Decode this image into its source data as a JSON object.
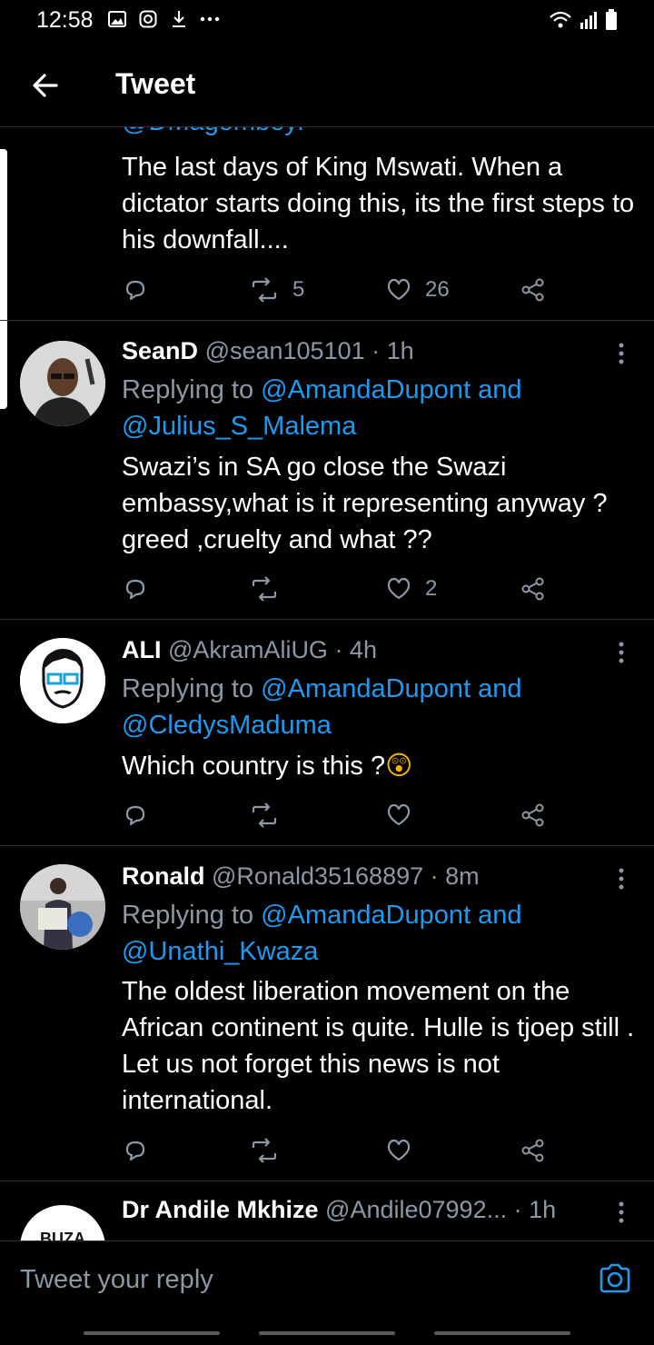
{
  "status": {
    "time": "12:58"
  },
  "header": {
    "title": "Tweet"
  },
  "tweets": [
    {
      "handle_partial": "@DMagombeyi",
      "text": "The last days of King Mswati. When a dictator starts doing this, its the first steps to his downfall....",
      "retweets": "5",
      "likes": "26"
    },
    {
      "name": "SeanD",
      "handle": "@sean105101 · 1h",
      "replying_prefix": "Replying to ",
      "mention1": "@AmandaDupont and",
      "mention2": "@Julius_S_Malema",
      "text": "Swazi’s in SA go close the Swazi embassy,what is it representing anyway ? greed ,cruelty and what ??",
      "retweets": "",
      "likes": "2"
    },
    {
      "name": "ALI",
      "handle": "@AkramAliUG · 4h",
      "replying_prefix": "Replying to ",
      "mention1": "@AmandaDupont and",
      "mention2": "@CledysMaduma",
      "text": "Which country is this ?",
      "emoji": "😲",
      "retweets": "",
      "likes": ""
    },
    {
      "name": "Ronald",
      "handle": "@Ronald35168897 · 8m",
      "replying_prefix": "Replying to ",
      "mention1": "@AmandaDupont and",
      "mention2": "@Unathi_Kwaza",
      "text": "The oldest liberation movement on the African continent is quite. Hulle is tjoep still . Let us not forget this news is not international.",
      "retweets": "",
      "likes": ""
    },
    {
      "name": "Dr Andile Mkhize",
      "handle": "@Andile07992...",
      "time": " · 1h",
      "avatar_text": "BUZA"
    }
  ],
  "compose": {
    "placeholder": "Tweet your reply"
  },
  "icons": {
    "back": "arrow-left-icon",
    "reply": "reply-icon",
    "retweet": "retweet-icon",
    "like": "heart-icon",
    "share": "share-icon",
    "more": "more-vertical-icon",
    "camera": "camera-icon"
  },
  "colors": {
    "accent": "#1d9bf0",
    "muted": "#8b98a5",
    "background": "#000000"
  }
}
